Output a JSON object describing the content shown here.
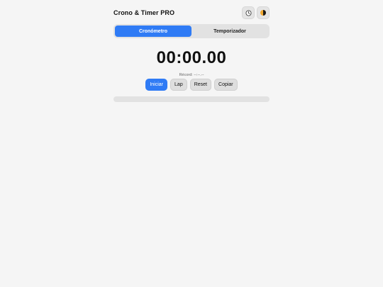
{
  "header": {
    "title": "Crono & Timer PRO",
    "history_icon": "clock-icon",
    "theme_icon": "contrast-icon"
  },
  "tabs": [
    {
      "label": "Cronómetro",
      "active": true
    },
    {
      "label": "Temporizador",
      "active": false
    }
  ],
  "stopwatch": {
    "time": "00:00.00",
    "record": "Récord: --:--.--",
    "buttons": {
      "start": "Iniciar",
      "lap": "Lap",
      "reset": "Reset",
      "copy": "Copiar"
    }
  },
  "colors": {
    "accent": "#2f7bf5",
    "background": "#f5f5f5"
  }
}
